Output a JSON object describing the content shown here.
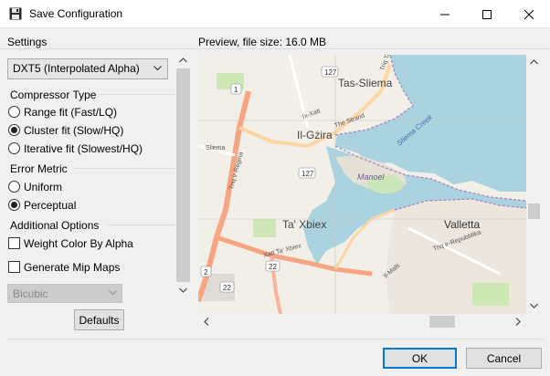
{
  "window": {
    "title": "Save Configuration"
  },
  "settings": {
    "label": "Settings",
    "format_value": "DXT5 (Interpolated Alpha)",
    "compressor_type": {
      "label": "Compressor Type",
      "options": [
        "Range fit (Fast/LQ)",
        "Cluster fit (Slow/HQ)",
        "Iterative fit (Slowest/HQ)"
      ],
      "selected": "Cluster fit (Slow/HQ)"
    },
    "error_metric": {
      "label": "Error Metric",
      "options": [
        "Uniform",
        "Perceptual"
      ],
      "selected": "Perceptual"
    },
    "additional_options": {
      "label": "Additional Options",
      "weight_color_by_alpha": "Weight Color By Alpha",
      "generate_mip_maps": "Generate Mip Maps",
      "weight_checked": false,
      "mip_checked": false,
      "mip_filter": "Bicubic"
    },
    "defaults_button": "Defaults"
  },
  "preview": {
    "label": "Preview, file size: 16.0 MB",
    "map_labels": {
      "tas_sliema": "Tas-Sliema",
      "il_gzira": "Il-Gżira",
      "ta_xbiex": "Ta' Xbiex",
      "valletta": "Valletta",
      "manoel": "Manoel",
      "sliema_creek": "Sliema Creek",
      "il_malti": "Il-Malti",
      "triq_ir_repubblika": "Triq ir-Repubblika",
      "triq_tas_sliema": "Triq Tas-Sliema",
      "ix_xatt": "Ix-Xatt",
      "the_strand": "The Strand",
      "triq_ir_regina": "Triq ir-Regina",
      "xatt_ta_xbiex": "Xatt Ta' Xbiex",
      "sliema": "Sliema",
      "road_127a": "127",
      "road_127b": "127",
      "road_1": "1",
      "road_22a": "22",
      "road_22b": "22",
      "road_2": "2"
    }
  },
  "footer": {
    "ok": "OK",
    "cancel": "Cancel"
  },
  "colors": {
    "accent": "#0078d7",
    "water": "#aad3df",
    "land": "#f2efe9",
    "road": "#f7a481"
  }
}
